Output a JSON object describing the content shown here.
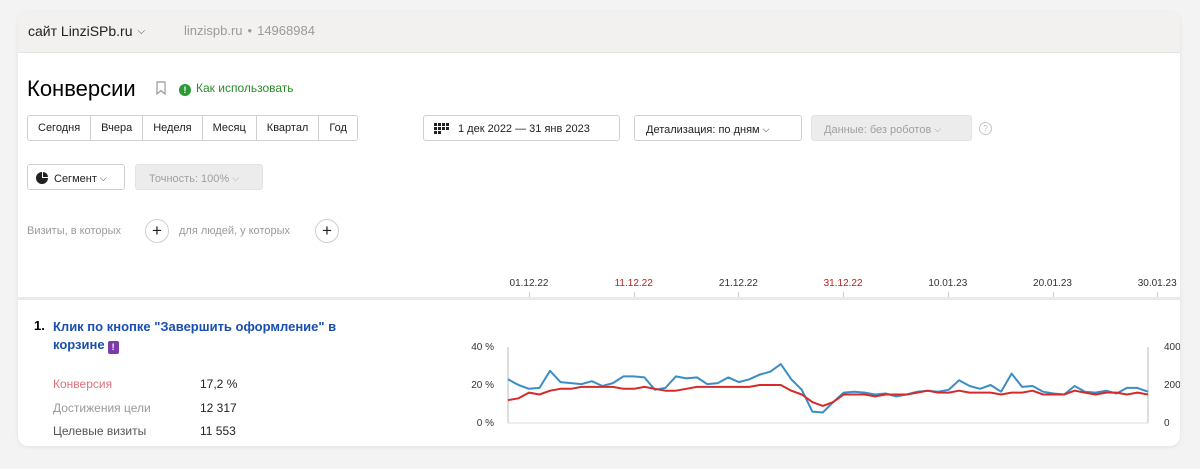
{
  "header": {
    "site_label": "сайт LinziSPb.ru",
    "domain": "linzispb.ru",
    "separator": "•",
    "counter_id": "14968984"
  },
  "page": {
    "title": "Конверсии",
    "howto_label": "Как использовать"
  },
  "period_tabs": [
    "Сегодня",
    "Вчера",
    "Неделя",
    "Месяц",
    "Квартал",
    "Год"
  ],
  "date_range": "1 дек 2022 — 31 янв 2023",
  "detail_select": "Детализация: по дням",
  "data_select": "Данные: без роботов",
  "segment_button": "Сегмент",
  "accuracy_select": "Точность: 100%",
  "filters": {
    "visits_label": "Визиты, в которых",
    "people_label": "для людей, у которых"
  },
  "timeline": [
    {
      "label": "01.12.22",
      "holiday": false
    },
    {
      "label": "11.12.22",
      "holiday": true
    },
    {
      "label": "21.12.22",
      "holiday": false
    },
    {
      "label": "31.12.22",
      "holiday": true
    },
    {
      "label": "10.01.23",
      "holiday": false
    },
    {
      "label": "20.01.23",
      "holiday": false
    },
    {
      "label": "30.01.23",
      "holiday": false
    }
  ],
  "goal": {
    "number": "1.",
    "title": "Клик по кнопке \"Завершить оформление\" в корзине",
    "metrics": [
      {
        "label": "Конверсия",
        "value": "17,2 %",
        "color": "#e0707a"
      },
      {
        "label": "Достижения цели",
        "value": "12 317",
        "color": "#9a9a9a"
      },
      {
        "label": "Целевые визиты",
        "value": "11 553",
        "color": "#555555"
      }
    ]
  },
  "chart_data": {
    "type": "line",
    "x": [
      "2022-12-01",
      "2022-12-02",
      "2022-12-03",
      "2022-12-04",
      "2022-12-05",
      "2022-12-06",
      "2022-12-07",
      "2022-12-08",
      "2022-12-09",
      "2022-12-10",
      "2022-12-11",
      "2022-12-12",
      "2022-12-13",
      "2022-12-14",
      "2022-12-15",
      "2022-12-16",
      "2022-12-17",
      "2022-12-18",
      "2022-12-19",
      "2022-12-20",
      "2022-12-21",
      "2022-12-22",
      "2022-12-23",
      "2022-12-24",
      "2022-12-25",
      "2022-12-26",
      "2022-12-27",
      "2022-12-28",
      "2022-12-29",
      "2022-12-30",
      "2022-12-31",
      "2023-01-01",
      "2023-01-02",
      "2023-01-03",
      "2023-01-04",
      "2023-01-05",
      "2023-01-06",
      "2023-01-07",
      "2023-01-08",
      "2023-01-09",
      "2023-01-10",
      "2023-01-11",
      "2023-01-12",
      "2023-01-13",
      "2023-01-14",
      "2023-01-15",
      "2023-01-16",
      "2023-01-17",
      "2023-01-18",
      "2023-01-19",
      "2023-01-20",
      "2023-01-21",
      "2023-01-22",
      "2023-01-23",
      "2023-01-24",
      "2023-01-25",
      "2023-01-26",
      "2023-01-27",
      "2023-01-28",
      "2023-01-29",
      "2023-01-30",
      "2023-01-31"
    ],
    "series": [
      {
        "axis": "right",
        "color": "#3a8ec5",
        "values": [
          230,
          200,
          180,
          185,
          275,
          215,
          210,
          205,
          220,
          195,
          210,
          245,
          245,
          240,
          175,
          185,
          245,
          235,
          240,
          205,
          210,
          240,
          215,
          230,
          255,
          270,
          310,
          230,
          175,
          60,
          55,
          110,
          160,
          165,
          160,
          150,
          155,
          140,
          150,
          165,
          170,
          165,
          175,
          225,
          195,
          180,
          200,
          165,
          260,
          190,
          195,
          165,
          155,
          150,
          195,
          165,
          160,
          170,
          155,
          185,
          185,
          165
        ]
      },
      {
        "axis": "left",
        "color": "#d62a2a",
        "values": [
          12,
          13,
          16,
          15,
          17,
          18,
          18,
          19,
          19,
          19,
          19,
          18,
          18,
          19,
          18,
          17,
          17,
          18,
          19,
          19,
          19,
          19,
          19,
          19,
          20,
          20,
          20,
          17,
          15,
          11,
          9,
          11,
          15,
          15,
          15,
          14,
          15,
          15,
          15,
          16,
          17,
          16,
          16,
          17,
          16,
          16,
          16,
          15,
          16,
          16,
          17,
          15,
          15,
          15,
          17,
          16,
          15,
          16,
          16,
          15,
          16,
          15
        ]
      }
    ],
    "y_left_ticks": [
      "40 %",
      "20 %",
      "0 %"
    ],
    "y_left_range": [
      0,
      40
    ],
    "y_right_ticks": [
      "400",
      "200",
      "0"
    ],
    "y_right_range": [
      0,
      400
    ],
    "grid": false
  }
}
